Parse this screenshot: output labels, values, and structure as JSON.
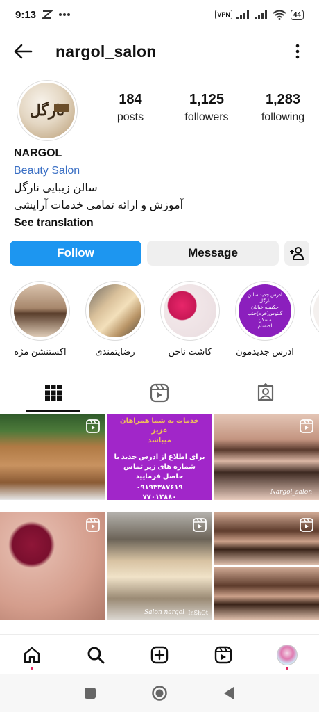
{
  "status_bar": {
    "time": "9:13",
    "vpn": "VPN",
    "battery": "44"
  },
  "header": {
    "username": "nargol_salon"
  },
  "profile": {
    "avatar_text": "نارگل",
    "stats": [
      {
        "value": "184",
        "label": "posts"
      },
      {
        "value": "1,125",
        "label": "followers"
      },
      {
        "value": "1,283",
        "label": "following"
      }
    ],
    "name": "NARGOL",
    "category": "Beauty Salon",
    "bio_lines": [
      "سالن زیبایی نارگل",
      "آموزش و ارائه تمامی خدمات آرایشی"
    ],
    "see_translation": "See translation"
  },
  "actions": {
    "follow": "Follow",
    "message": "Message"
  },
  "highlights": [
    {
      "label": "اکستنشن مژه"
    },
    {
      "label": "رضایتمندی"
    },
    {
      "label": "کاشت ناخن"
    },
    {
      "label": "ادرس جدیدمون"
    }
  ],
  "highlight_address_text": [
    "ادرس جدید سالن نارگل",
    "حکیمیه خیابان",
    "گلنوس(خرم)جنب مسکن",
    "احتشام"
  ],
  "grid": {
    "post2": {
      "top": "خدمات به شما همراهان عزیز",
      "top2": "میباشد",
      "body": "برای اطلاع از ادرس جدید با شماره های زیر تماس حاصل فرمایید",
      "phone1": "۰۹۱۹۳۳۸۷۶۱۹",
      "phone2": "۷۷۰۱۲۸۸۰"
    },
    "caption_eyebrow": "Nargol_salon",
    "caption_hair": "Salon nargol",
    "caption_hair_tag": "InShOt"
  },
  "colors": {
    "follow_blue": "#1d96f0",
    "link_blue": "#3a6fc4",
    "notification_dot": "#e0245e"
  },
  "icons": [
    "back-arrow-icon",
    "more-vertical-icon",
    "add-person-icon",
    "grid-icon",
    "reels-icon",
    "tagged-icon",
    "home-icon",
    "search-icon",
    "create-icon",
    "reels-nav-icon",
    "square-icon",
    "circle-icon",
    "triangle-back-icon"
  ]
}
